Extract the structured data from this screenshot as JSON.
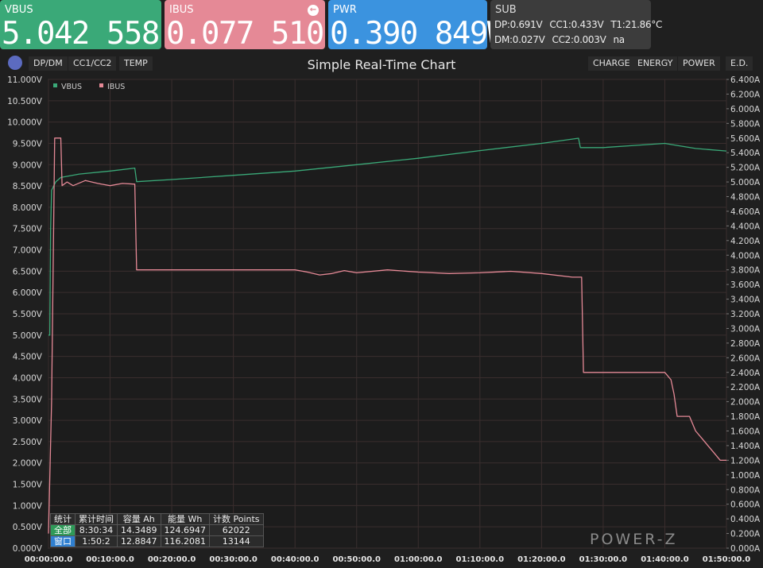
{
  "cards": {
    "vbus": {
      "label": "VBUS",
      "value": "5.042 558 V"
    },
    "ibus": {
      "label": "IBUS",
      "value": "0.077 510 A"
    },
    "pwr": {
      "label": "PWR",
      "value": "0.390 849W"
    },
    "sub": {
      "label": "SUB",
      "dp": "DP:0.691V",
      "cc1": "CC1:0.433V",
      "t1": "T1:21.86°C",
      "dm": "DM:0.027V",
      "cc2": "CC2:0.003V",
      "na": "na"
    }
  },
  "toolbar": {
    "left_tabs": [
      "DP/DM",
      "CC1/CC2",
      "TEMP"
    ],
    "right_tabs": [
      "CHARGE",
      "ENERGY",
      "POWER",
      "E.D."
    ],
    "title": "Simple Real-Time Chart"
  },
  "stats": {
    "headers": [
      "统计",
      "累计时间",
      "容量 Ah",
      "能量 Wh",
      "计数 Points"
    ],
    "rows": [
      [
        "全部",
        "8:30:34",
        "14.3489",
        "124.6947",
        "62022"
      ],
      [
        "窗口",
        "1:50:2",
        "12.8847",
        "116.2081",
        "13144"
      ]
    ]
  },
  "watermark": "POWER-Z",
  "colors": {
    "vbus": "#3aa978",
    "ibus": "#e58996",
    "pwr": "#3b93df",
    "sub": "#3c3c3c"
  },
  "chart_data": {
    "type": "line",
    "title": "Simple Real-Time Chart",
    "legend_position": "top-left",
    "grid": true,
    "x_unit": "hh:mm:ss.s",
    "x_ticks": [
      "00:00:00.0",
      "00:10:00.0",
      "00:20:00.0",
      "00:30:00.0",
      "00:40:00.0",
      "00:50:00.0",
      "01:00:00.0",
      "01:10:00.0",
      "01:20:00.0",
      "01:30:00.0",
      "01:40:00.0",
      "01:50:00.0"
    ],
    "xlim_min": [
      0,
      110
    ],
    "left_axis": {
      "ylim": [
        0,
        11
      ],
      "step": 0.5,
      "unit": "V"
    },
    "right_axis": {
      "ylim": [
        0,
        6.4
      ],
      "step": 0.2,
      "unit": "A"
    },
    "series": [
      {
        "name": "VBUS",
        "axis": "left",
        "color": "#3aa978",
        "points": [
          [
            0,
            5.0
          ],
          [
            0.2,
            5.0
          ],
          [
            0.35,
            7.5
          ],
          [
            0.5,
            8.4
          ],
          [
            1.2,
            8.6
          ],
          [
            2,
            8.7
          ],
          [
            5,
            8.78
          ],
          [
            10,
            8.85
          ],
          [
            14,
            8.92
          ],
          [
            14.3,
            8.6
          ],
          [
            20,
            8.65
          ],
          [
            30,
            8.75
          ],
          [
            40,
            8.85
          ],
          [
            50,
            9.0
          ],
          [
            60,
            9.15
          ],
          [
            70,
            9.33
          ],
          [
            80,
            9.5
          ],
          [
            86,
            9.62
          ],
          [
            86.3,
            9.4
          ],
          [
            90,
            9.4
          ],
          [
            95,
            9.45
          ],
          [
            100,
            9.5
          ],
          [
            102,
            9.45
          ],
          [
            105,
            9.38
          ],
          [
            110,
            9.32
          ]
        ]
      },
      {
        "name": "IBUS",
        "axis": "right",
        "color": "#e58996",
        "points": [
          [
            0,
            0.2
          ],
          [
            0.5,
            2.0
          ],
          [
            1,
            5.6
          ],
          [
            2,
            5.6
          ],
          [
            2.2,
            4.95
          ],
          [
            3,
            5.0
          ],
          [
            4,
            4.95
          ],
          [
            6,
            5.02
          ],
          [
            8,
            4.98
          ],
          [
            10,
            4.95
          ],
          [
            12,
            4.98
          ],
          [
            14,
            4.97
          ],
          [
            14.3,
            3.8
          ],
          [
            40,
            3.8
          ],
          [
            42,
            3.77
          ],
          [
            44,
            3.73
          ],
          [
            46,
            3.75
          ],
          [
            48,
            3.79
          ],
          [
            50,
            3.76
          ],
          [
            55,
            3.8
          ],
          [
            60,
            3.77
          ],
          [
            65,
            3.75
          ],
          [
            70,
            3.76
          ],
          [
            75,
            3.78
          ],
          [
            80,
            3.75
          ],
          [
            85,
            3.7
          ],
          [
            86.5,
            3.7
          ],
          [
            86.8,
            2.4
          ],
          [
            100,
            2.4
          ],
          [
            101,
            2.3
          ],
          [
            101.5,
            2.1
          ],
          [
            102,
            1.8
          ],
          [
            104,
            1.8
          ],
          [
            105,
            1.6
          ],
          [
            106,
            1.5
          ],
          [
            107,
            1.4
          ],
          [
            108,
            1.3
          ],
          [
            109,
            1.2
          ],
          [
            110,
            1.2
          ]
        ]
      }
    ]
  }
}
